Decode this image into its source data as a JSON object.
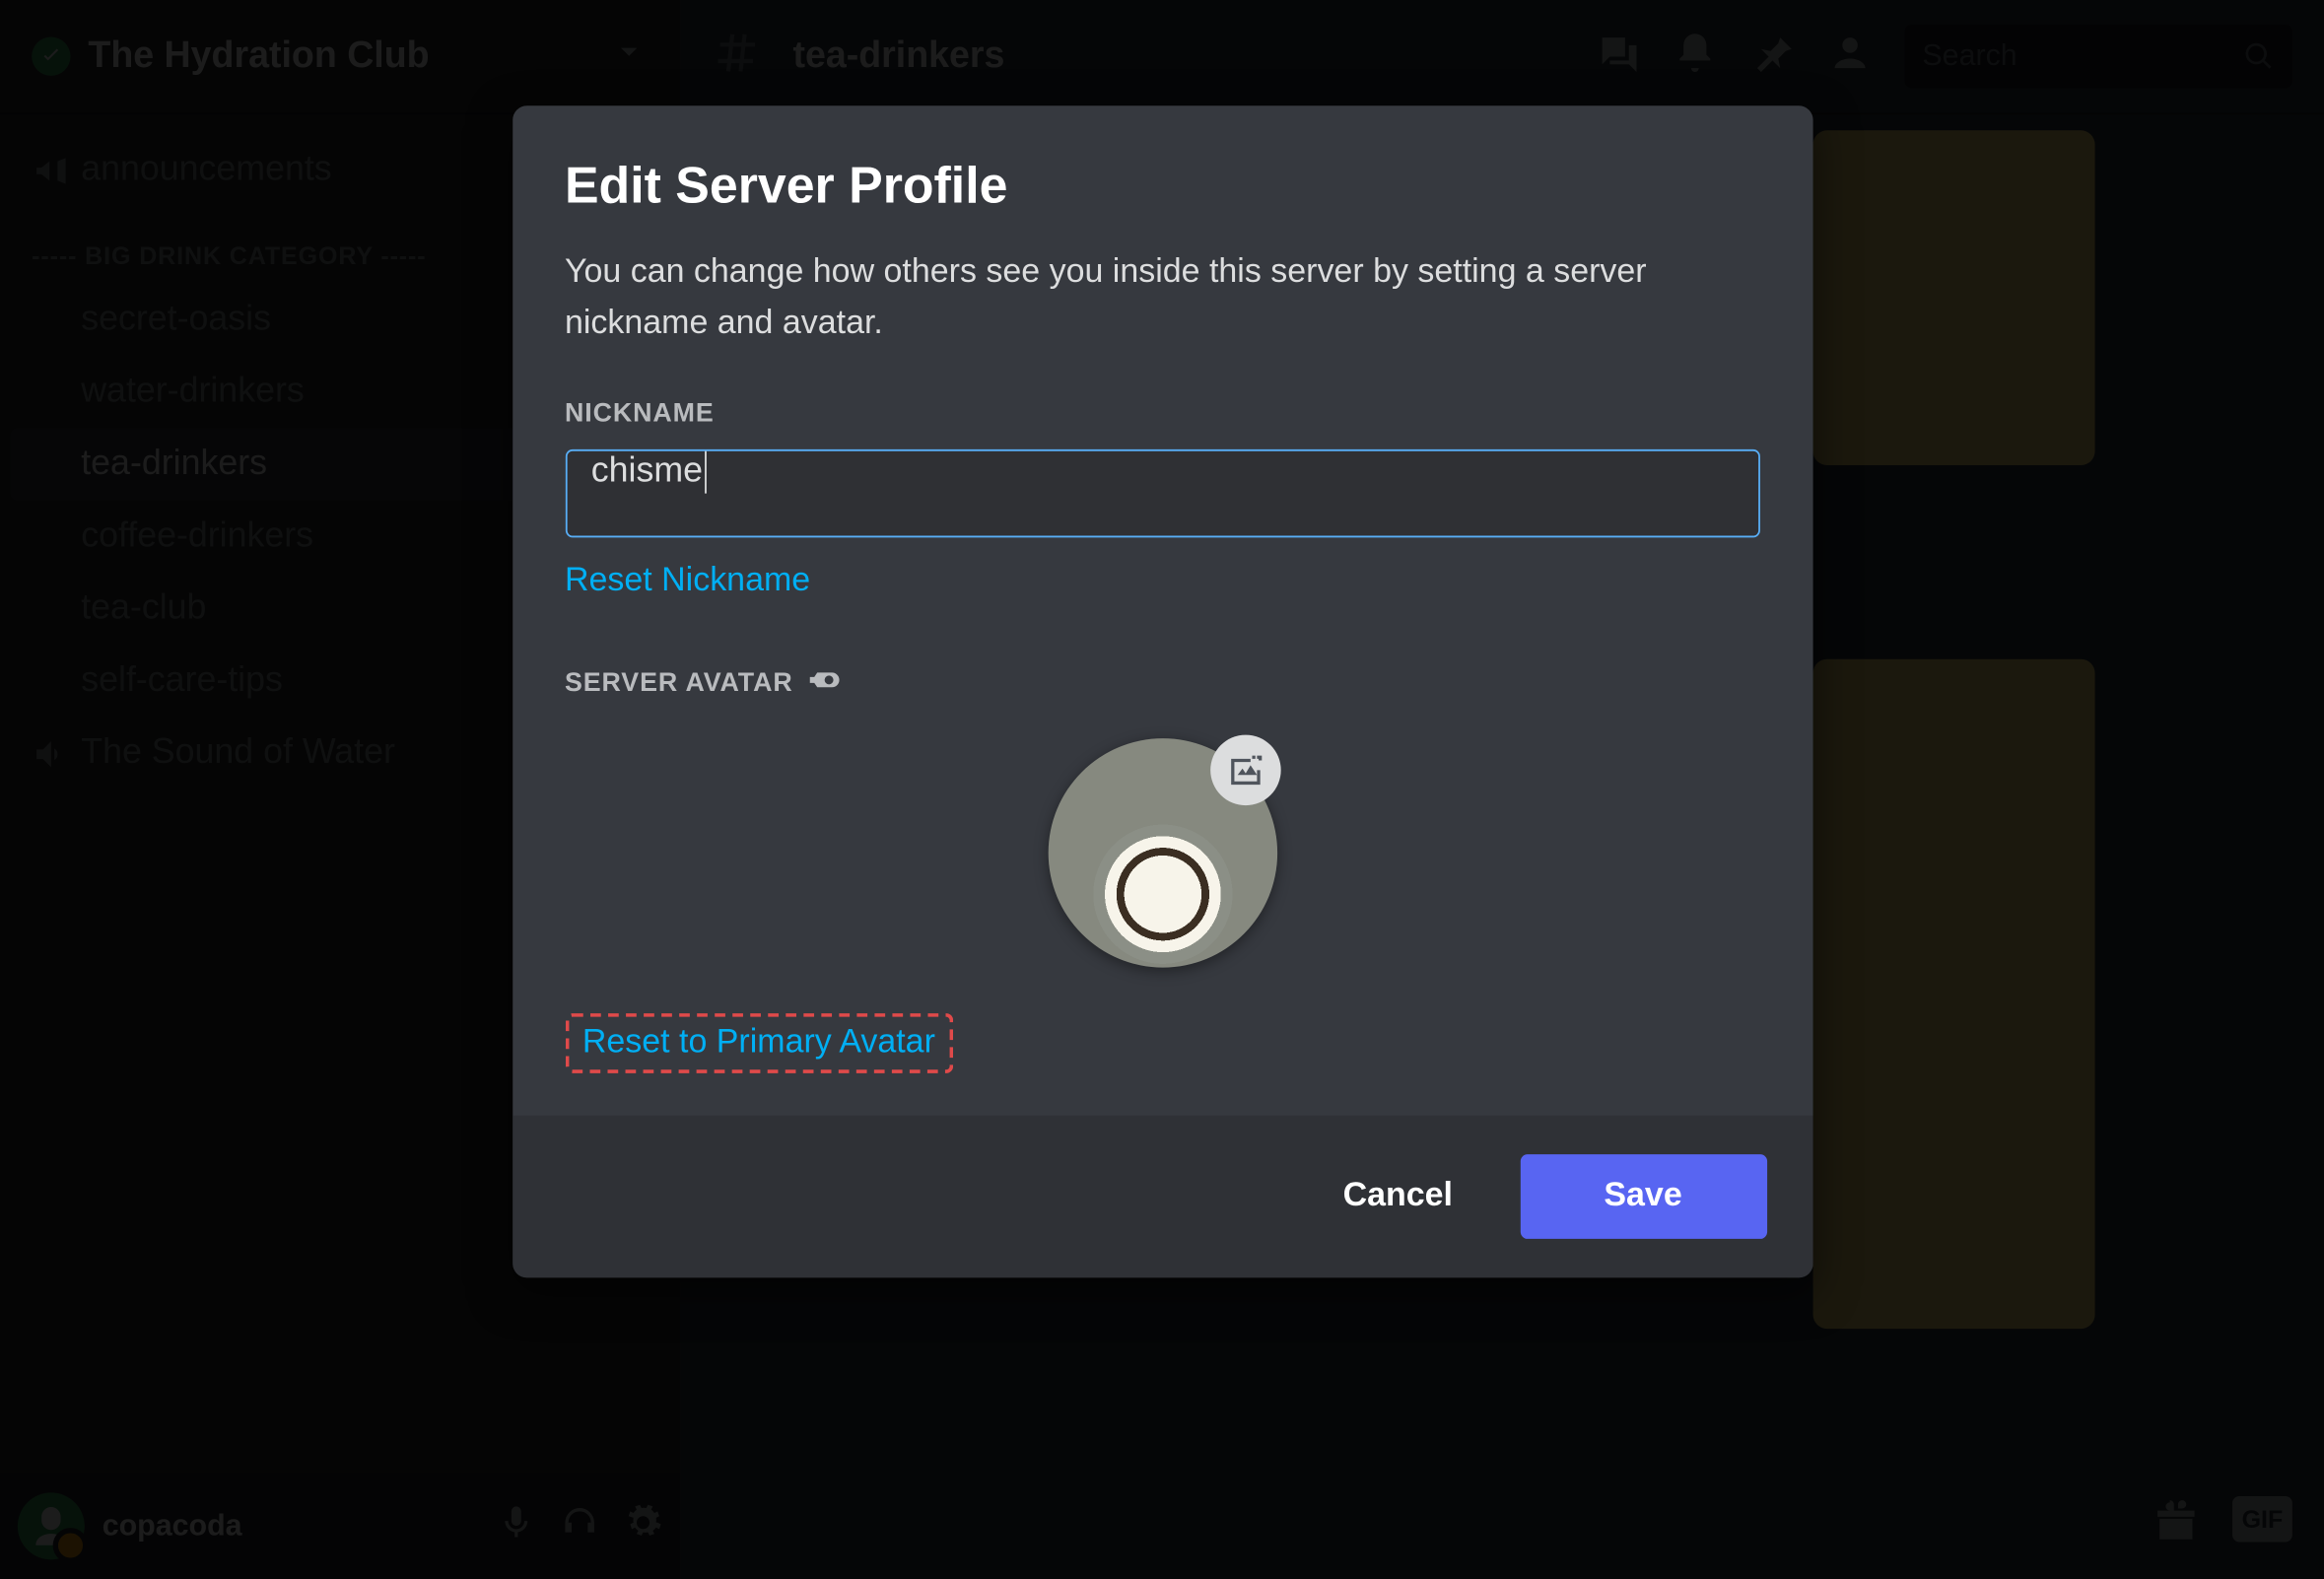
{
  "server": {
    "name": "The Hydration Club"
  },
  "sidebar": {
    "announce": "announcements",
    "category": "----- BIG DRINK CATEGORY -----",
    "channels": [
      "secret-oasis",
      "water-drinkers",
      "tea-drinkers",
      "coffee-drinkers",
      "tea-club",
      "self-care-tips",
      "The Sound of Water"
    ]
  },
  "user": {
    "name": "copacoda"
  },
  "topbar": {
    "channel": "tea-drinkers",
    "search_placeholder": "Search"
  },
  "gif_label": "GIF",
  "modal": {
    "title": "Edit Server Profile",
    "desc": "You can change how others see you inside this server by setting a server nickname and avatar.",
    "nickname_label": "NICKNAME",
    "nickname_value": "chisme",
    "reset_nickname": "Reset Nickname",
    "avatar_label": "SERVER AVATAR",
    "reset_avatar": "Reset to Primary Avatar",
    "cancel": "Cancel",
    "save": "Save"
  }
}
